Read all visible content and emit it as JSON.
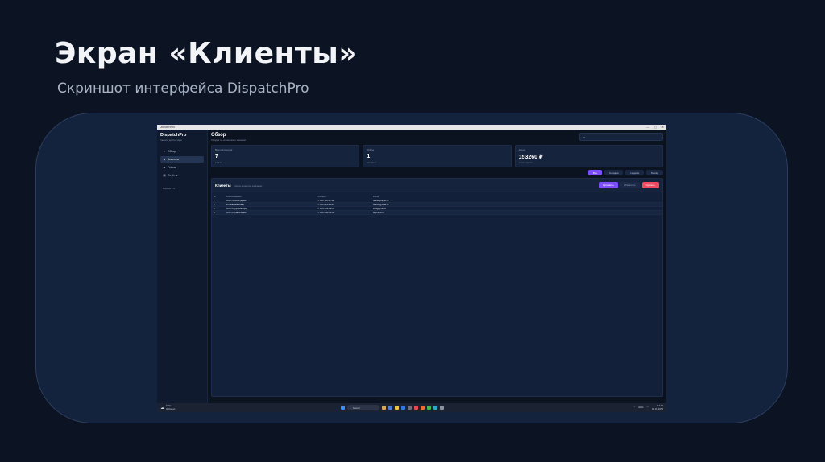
{
  "slide": {
    "title": "Экран «Клиенты»",
    "subtitle": "Скриншот интерфейса DispatchPro"
  },
  "window": {
    "title": "DispatchPro",
    "controls": [
      "—",
      "▢",
      "✕"
    ]
  },
  "sidebar": {
    "brand": "DispatchPro",
    "brand_sub": "панель диспетчера",
    "items": [
      {
        "label": "Обзор",
        "icon": "home-icon"
      },
      {
        "label": "Клиенты",
        "icon": "user-icon",
        "active": true
      },
      {
        "label": "Рейсы",
        "icon": "truck-icon"
      },
      {
        "label": "Отчёты",
        "icon": "report-icon"
      }
    ],
    "footer": "Версия 1.0"
  },
  "header": {
    "title": "Обзор",
    "subtitle": "Сводка по клиентам и заказам",
    "search_placeholder": "⌕"
  },
  "stats": [
    {
      "label": "Всего клиентов",
      "value": "7",
      "foot": "в базе"
    },
    {
      "label": "Рейсы",
      "value": "1",
      "foot": "активных"
    },
    {
      "label": "Доход",
      "value": "153260 ₽",
      "foot": "за всё время"
    }
  ],
  "filters": [
    {
      "label": "Все",
      "active": true
    },
    {
      "label": "Сегодня"
    },
    {
      "label": "Неделя"
    },
    {
      "label": "Месяц"
    }
  ],
  "clients_panel": {
    "title": "Клиенты",
    "subtitle": "список клиентов компании",
    "add_label": "Добавить",
    "edit_label": "Изменить",
    "delete_label": "Удалить",
    "columns": [
      "ID",
      "Имя/Название",
      "Телефон",
      "Email"
    ],
    "rows": [
      [
        "1",
        "ООО «ЛогистДом»",
        "+7 900 111-11-11",
        "office@logist.ru"
      ],
      [
        "2",
        "ИП Иванов Иван",
        "+7 900 222-22-22",
        "ivanov@mail.ru"
      ],
      [
        "3",
        "ООО «ГрузВектор»",
        "+7 900 333-33-33",
        "info@gruz.ru"
      ],
      [
        "4",
        "ООО «ТрансЛайн»",
        "+7 900 444-44-44",
        "tl@trans.ru"
      ]
    ]
  },
  "taskbar": {
    "weather_temp": "19°C",
    "weather_desc": "Облачно",
    "search_label": "Search",
    "lang": "ENG",
    "time": "13:20",
    "date": "14.05.2025"
  },
  "colors": {
    "accent": "#7c4dff",
    "danger": "#ef4a5f",
    "background": "#0c1423",
    "frame": "#13223d"
  }
}
